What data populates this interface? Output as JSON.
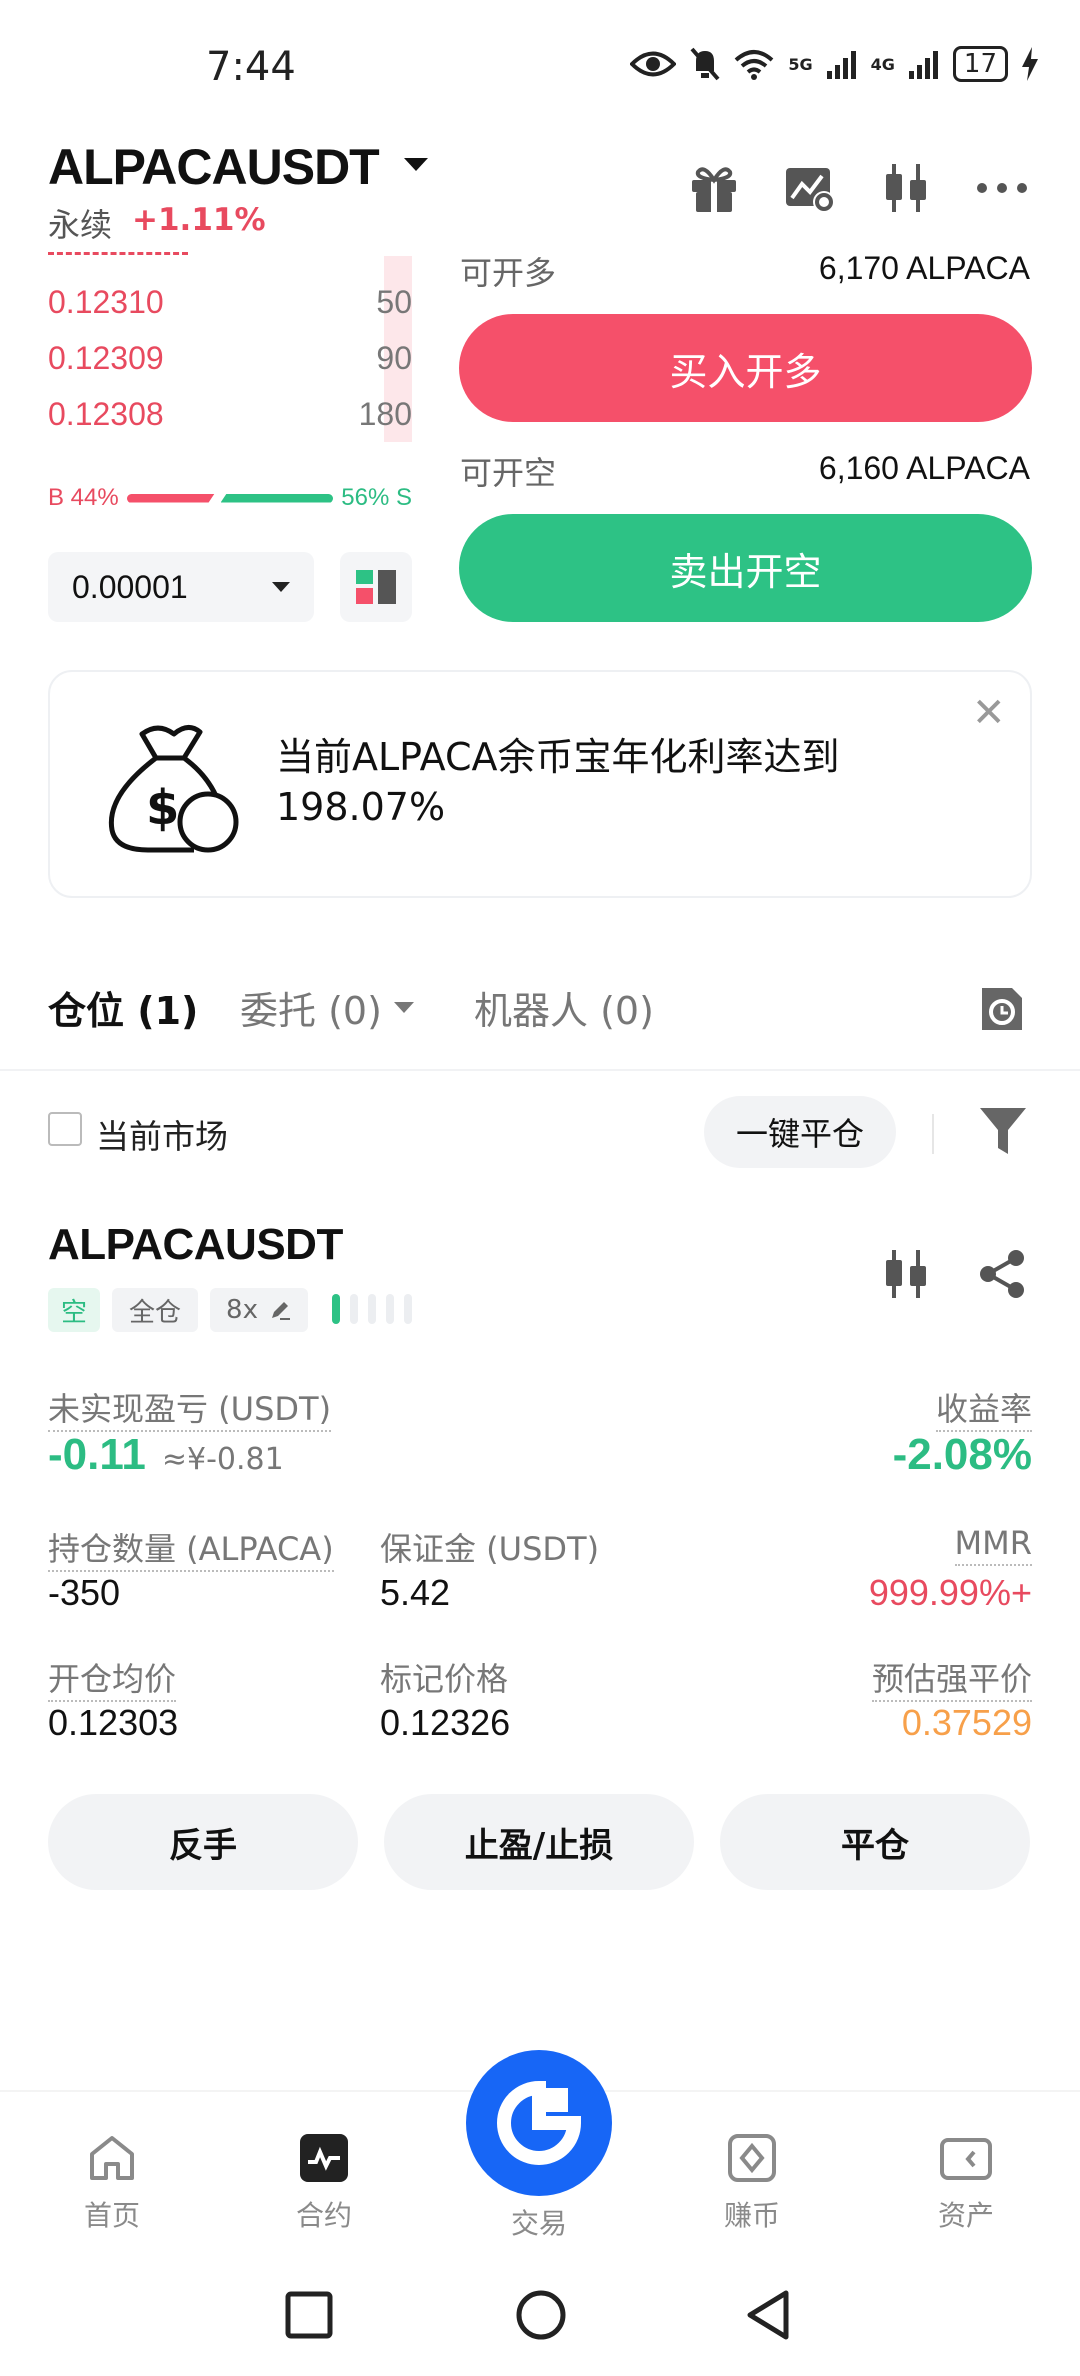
{
  "status_bar": {
    "time": "7:44",
    "network": "5G",
    "network2": "4G",
    "battery": "17"
  },
  "header": {
    "pair": "ALPACAUSDT",
    "contract_type": "永续",
    "change": "+1.11%"
  },
  "order_book": {
    "asks": [
      {
        "price": "0.12310",
        "qty": "50"
      },
      {
        "price": "0.12309",
        "qty": "90"
      },
      {
        "price": "0.12308",
        "qty": "180"
      }
    ],
    "buy_ratio": "B 44%",
    "sell_ratio": "56% S",
    "buy_fraction": 0.44,
    "tick_size": "0.00001"
  },
  "order_panel": {
    "long_avail_label": "可开多",
    "long_avail_value": "6,170 ALPACA",
    "long_button": "买入开多",
    "short_avail_label": "可开空",
    "short_avail_value": "6,160 ALPACA",
    "short_button": "卖出开空"
  },
  "banner": {
    "text": "当前ALPACA余币宝年化利率达到198.07%"
  },
  "tabs": [
    {
      "label": "仓位 (1)"
    },
    {
      "label": "委托 (0)"
    },
    {
      "label": "机器人 (0)"
    }
  ],
  "filter": {
    "current_market": "当前市场",
    "close_all": "一键平仓"
  },
  "position": {
    "symbol": "ALPACAUSDT",
    "side_tag": "空",
    "margin_mode": "全仓",
    "leverage": "8x",
    "risk_level": 0.2,
    "unrealized_pnl_label": "未实现盈亏 (USDT)",
    "unrealized_pnl": "-0.11",
    "unrealized_pnl_cny": "≈¥-0.81",
    "roe_label": "收益率",
    "roe": "-2.08%",
    "size_label": "持仓数量 (ALPACA)",
    "size": "-350",
    "margin_label": "保证金 (USDT)",
    "margin": "5.42",
    "mmr_label": "MMR",
    "mmr": "999.99%+",
    "entry_label": "开仓均价",
    "entry": "0.12303",
    "mark_label": "标记价格",
    "mark": "0.12326",
    "liq_label": "预估强平价",
    "liq": "0.37529",
    "buttons": [
      "反手",
      "止盈/止损",
      "平仓"
    ]
  },
  "bottom_nav": [
    {
      "label": "首页",
      "icon": "home-icon"
    },
    {
      "label": "合约",
      "icon": "futures-icon"
    },
    {
      "label": "交易",
      "icon": "trade-icon"
    },
    {
      "label": "赚币",
      "icon": "earn-icon"
    },
    {
      "label": "资产",
      "icon": "wallet-icon"
    }
  ]
}
